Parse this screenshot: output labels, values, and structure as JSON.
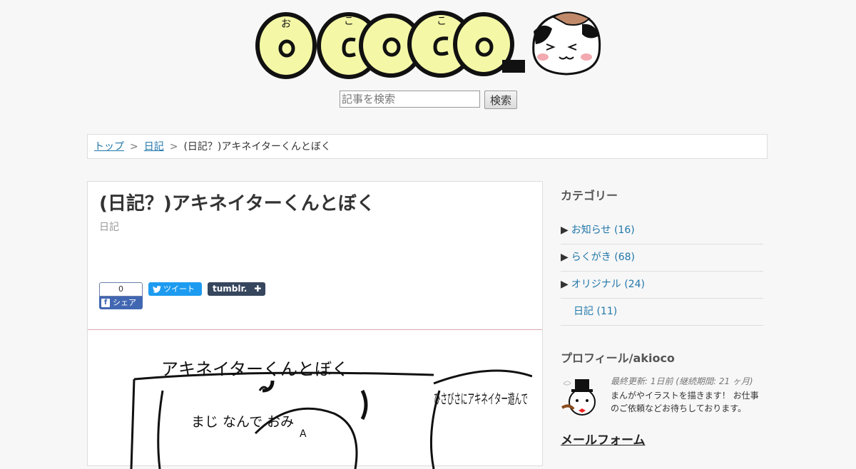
{
  "logo": {
    "text": "ococo",
    "ruby": [
      "お",
      "こ",
      "こ"
    ]
  },
  "search": {
    "placeholder": "記事を検索",
    "button": "検索"
  },
  "breadcrumb": {
    "items": [
      "トップ",
      "日記"
    ],
    "current": "(日記？)アキネイターくんとぼく",
    "separator": ">"
  },
  "article": {
    "title": "(日記？)アキネイターくんとぼく",
    "category": "日記",
    "share": {
      "fb_count": "0",
      "fb_label": "シェア",
      "tweet": "ツイート",
      "tumblr": "tumblr."
    },
    "comic": {
      "title": "アキネイターくんとぼく",
      "bubble": "ひさびさにアキネイター遊んで",
      "side": "まじ なんで おみ",
      "letter": "A"
    }
  },
  "sidebar": {
    "category_title": "カテゴリー",
    "categories": [
      {
        "label": "お知らせ (16)",
        "arrow": true
      },
      {
        "label": "らくがき (68)",
        "arrow": true
      },
      {
        "label": "オリジナル (24)",
        "arrow": true
      },
      {
        "label": "日記 (11)",
        "arrow": false
      }
    ],
    "profile_title": "プロフィール/akioco",
    "updated": "最終更新: 1日前 (継続期間: 21 ヶ月)",
    "bio": "まんがやイラストを描きます！ お仕事のご依頼などお待ちしております。",
    "mail": "メールフォーム"
  },
  "colors": {
    "logo_yellow": "#f4f8a6",
    "link": "#2277aa",
    "divider": "#d8a9a9"
  }
}
